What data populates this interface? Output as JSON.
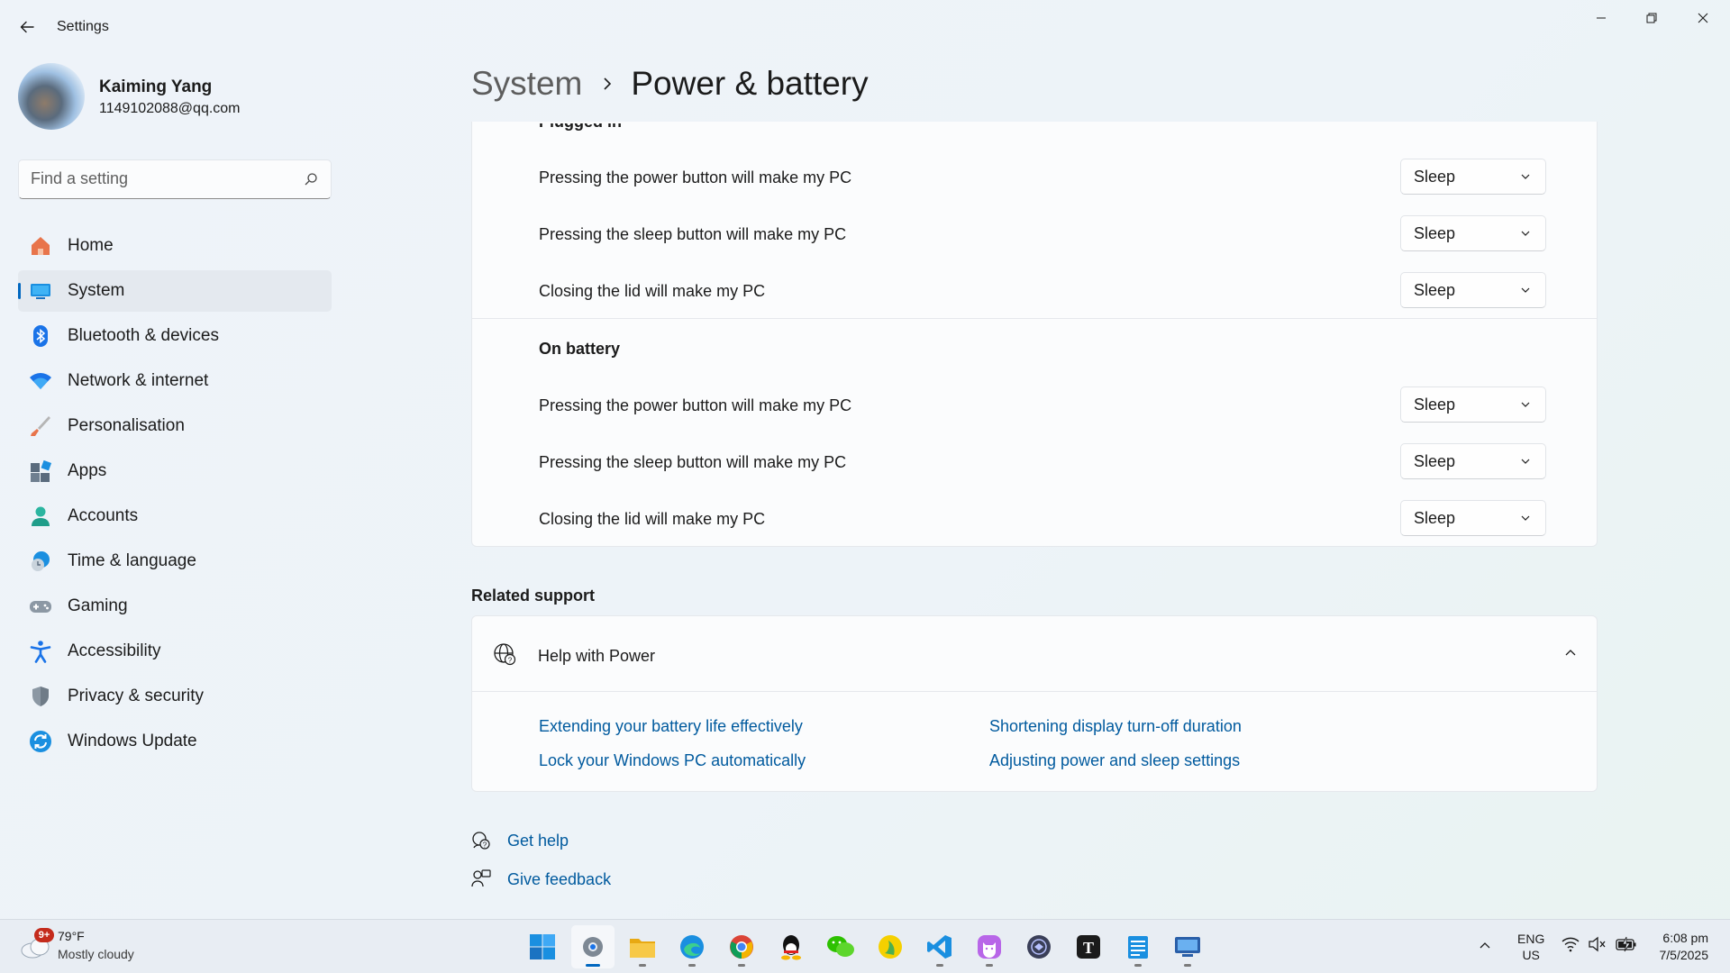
{
  "window": {
    "title": "Settings"
  },
  "profile": {
    "name": "Kaiming Yang",
    "email": "1149102088@qq.com"
  },
  "search": {
    "placeholder": "Find a setting"
  },
  "nav": {
    "items": [
      {
        "label": "Home",
        "icon": "home-icon"
      },
      {
        "label": "System",
        "icon": "system-icon",
        "active": true
      },
      {
        "label": "Bluetooth & devices",
        "icon": "bluetooth-icon"
      },
      {
        "label": "Network & internet",
        "icon": "wifi-icon"
      },
      {
        "label": "Personalisation",
        "icon": "brush-icon"
      },
      {
        "label": "Apps",
        "icon": "apps-icon"
      },
      {
        "label": "Accounts",
        "icon": "accounts-icon"
      },
      {
        "label": "Time & language",
        "icon": "time-language-icon"
      },
      {
        "label": "Gaming",
        "icon": "gamepad-icon"
      },
      {
        "label": "Accessibility",
        "icon": "accessibility-icon"
      },
      {
        "label": "Privacy & security",
        "icon": "shield-icon"
      },
      {
        "label": "Windows Update",
        "icon": "update-icon"
      }
    ]
  },
  "header": {
    "parent": "System",
    "current": "Power & battery"
  },
  "plugged_in": {
    "heading": "Plugged in",
    "rows": [
      {
        "label": "Pressing the power button will make my PC",
        "value": "Sleep"
      },
      {
        "label": "Pressing the sleep button will make my PC",
        "value": "Sleep"
      },
      {
        "label": "Closing the lid will make my PC",
        "value": "Sleep"
      }
    ]
  },
  "on_battery": {
    "heading": "On battery",
    "rows": [
      {
        "label": "Pressing the power button will make my PC",
        "value": "Sleep"
      },
      {
        "label": "Pressing the sleep button will make my PC",
        "value": "Sleep"
      },
      {
        "label": "Closing the lid will make my PC",
        "value": "Sleep"
      }
    ]
  },
  "related": {
    "heading": "Related support",
    "help_title": "Help with Power",
    "links": [
      "Extending your battery life effectively",
      "Shortening display turn-off duration",
      "Lock your Windows PC automatically",
      "Adjusting power and sleep settings"
    ]
  },
  "footer": {
    "get_help": "Get help",
    "give_feedback": "Give feedback"
  },
  "taskbar": {
    "weather": {
      "badge": "9+",
      "temp": "79°F",
      "desc": "Mostly cloudy"
    },
    "apps": [
      "start-icon",
      "settings-icon",
      "file-explorer-icon",
      "edge-icon",
      "chrome-icon",
      "qq-icon",
      "wechat-icon",
      "app-yellow-icon",
      "vscode-icon",
      "cat-app-icon",
      "dark-app-icon",
      "typora-icon",
      "notepad-icon",
      "remote-desktop-icon"
    ],
    "lang": {
      "line1": "ENG",
      "line2": "US"
    },
    "clock": {
      "time": "6:08 pm",
      "date": "7/5/2025"
    }
  },
  "colors": {
    "accent": "#0067c0",
    "link": "#005a9e"
  }
}
